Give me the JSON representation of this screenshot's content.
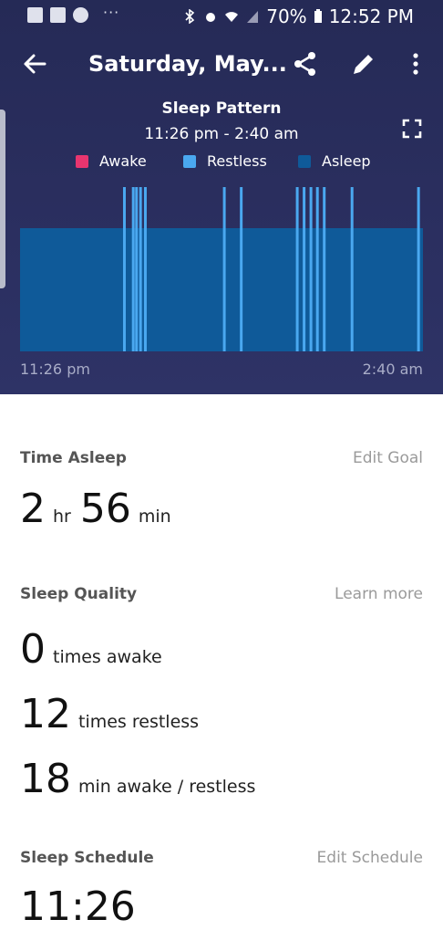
{
  "status_bar": {
    "battery": "70%",
    "time": "12:52 PM",
    "overflow": "···"
  },
  "toolbar": {
    "title": "Saturday, May...",
    "back_icon": "back-arrow-icon",
    "share_icon": "share-icon",
    "edit_icon": "pencil-icon",
    "more_icon": "more-vertical-icon"
  },
  "chart_title": "Sleep Pattern",
  "chart_range": "11:26 pm - 2:40 am",
  "legend": [
    {
      "label": "Awake",
      "color": "#e8356f"
    },
    {
      "label": "Restless",
      "color": "#4aa8f0"
    },
    {
      "label": "Asleep",
      "color": "#0f5a99"
    }
  ],
  "chart_data": {
    "type": "bar",
    "x_start": "11:26 pm",
    "x_end": "2:40 am",
    "series_asleep": {
      "name": "Asleep",
      "from": 0,
      "to": 1
    },
    "restless_marks": [
      0.259,
      0.281,
      0.289,
      0.299,
      0.311,
      0.507,
      0.549,
      0.688,
      0.705,
      0.722,
      0.738,
      0.755,
      0.824,
      0.989
    ],
    "awake_marks": []
  },
  "axis": {
    "start": "11:26 pm",
    "end": "2:40 am"
  },
  "time_asleep": {
    "heading": "Time Asleep",
    "action": "Edit Goal",
    "hours": "2",
    "hours_unit": "hr",
    "minutes": "56",
    "minutes_unit": "min"
  },
  "sleep_quality": {
    "heading": "Sleep Quality",
    "action": "Learn more",
    "awake_count": "0",
    "awake_label": "times awake",
    "restless_count": "12",
    "restless_label": "times restless",
    "minutes_count": "18",
    "minutes_label": "min awake / restless"
  },
  "sleep_schedule": {
    "heading": "Sleep Schedule",
    "action": "Edit Schedule",
    "value": "11:26"
  }
}
